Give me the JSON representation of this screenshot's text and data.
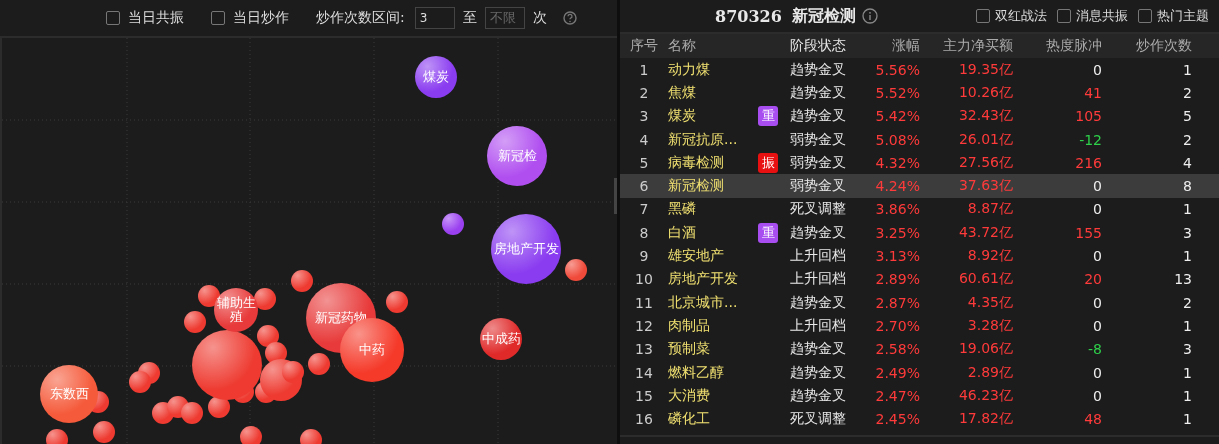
{
  "filter_bar": {
    "checkboxes": [
      {
        "label": "当日共振",
        "checked": false
      },
      {
        "label": "当日炒作",
        "checked": false
      }
    ],
    "range_label": "炒作次数区间:",
    "range_from": {
      "value": "3"
    },
    "range_sep": "至",
    "range_to": {
      "placeholder": "不限"
    },
    "range_unit": "次"
  },
  "bubble_chart": {
    "bubbles": [
      {
        "label": "煤炭",
        "color": "#8a3cf0"
      },
      {
        "label": "新冠检",
        "color": "#b04ef0"
      },
      {
        "label": "房地产开发",
        "color": "#8a3cf0"
      },
      {
        "label": "辅助生殖",
        "color": "#e83a3a"
      },
      {
        "label": "新冠药物",
        "color": "#e83a3a"
      },
      {
        "label": "中药",
        "color": "#f53a2a"
      },
      {
        "label": "中成药",
        "color": "#e02a2a"
      },
      {
        "label": "东数西",
        "color": "#f55a3a"
      }
    ]
  },
  "detail": {
    "code": "870326",
    "title": "新冠检测",
    "options": [
      {
        "label": "双红战法",
        "checked": false
      },
      {
        "label": "消息共振",
        "checked": false
      },
      {
        "label": "热门主题",
        "checked": false
      }
    ],
    "columns": [
      "序号",
      "名称",
      "阶段状态",
      "涨幅",
      "主力净买额",
      "热度脉冲",
      "炒作次数"
    ],
    "rows": [
      {
        "no": "1",
        "name": "动力煤",
        "stage": "趋势金叉",
        "change": "5.56%",
        "net_buy": "19.35亿",
        "heat": {
          "value": "0",
          "color": "#eeeeee"
        },
        "count": "1",
        "selected": false
      },
      {
        "no": "2",
        "name": "焦煤",
        "stage": "趋势金叉",
        "change": "5.52%",
        "net_buy": "10.26亿",
        "heat": {
          "value": "41",
          "color": "#ff3a3a"
        },
        "count": "2",
        "selected": false
      },
      {
        "no": "3",
        "name": "煤炭",
        "tag": {
          "text": "重",
          "color": "#a84ef0"
        },
        "stage": "趋势金叉",
        "change": "5.42%",
        "net_buy": "32.43亿",
        "heat": {
          "value": "105",
          "color": "#ff3a3a"
        },
        "count": "5",
        "selected": false
      },
      {
        "no": "4",
        "name": "新冠抗原...",
        "stage": "弱势金叉",
        "change": "5.08%",
        "net_buy": "26.01亿",
        "heat": {
          "value": "-12",
          "color": "#2ed04a"
        },
        "count": "2",
        "selected": false
      },
      {
        "no": "5",
        "name": "病毒检测",
        "tag": {
          "text": "振",
          "color": "#e81010"
        },
        "stage": "弱势金叉",
        "change": "4.32%",
        "net_buy": "27.56亿",
        "heat": {
          "value": "216",
          "color": "#ff3a3a"
        },
        "count": "4",
        "selected": false
      },
      {
        "no": "6",
        "name": "新冠检测",
        "stage": "弱势金叉",
        "change": "4.24%",
        "net_buy": "37.63亿",
        "heat": {
          "value": "0",
          "color": "#eeeeee"
        },
        "count": "8",
        "selected": true
      },
      {
        "no": "7",
        "name": "黑磷",
        "stage": "死叉调整",
        "change": "3.86%",
        "net_buy": "8.87亿",
        "heat": {
          "value": "0",
          "color": "#eeeeee"
        },
        "count": "1",
        "selected": false
      },
      {
        "no": "8",
        "name": "白酒",
        "tag": {
          "text": "重",
          "color": "#a84ef0"
        },
        "stage": "趋势金叉",
        "change": "3.25%",
        "net_buy": "43.72亿",
        "heat": {
          "value": "155",
          "color": "#ff3a3a"
        },
        "count": "3",
        "selected": false
      },
      {
        "no": "9",
        "name": "雄安地产",
        "stage": "上升回档",
        "change": "3.13%",
        "net_buy": "8.92亿",
        "heat": {
          "value": "0",
          "color": "#eeeeee"
        },
        "count": "1",
        "selected": false
      },
      {
        "no": "10",
        "name": "房地产开发",
        "stage": "上升回档",
        "change": "2.89%",
        "net_buy": "60.61亿",
        "heat": {
          "value": "20",
          "color": "#ff3a3a"
        },
        "count": "13",
        "selected": false
      },
      {
        "no": "11",
        "name": "北京城市...",
        "stage": "趋势金叉",
        "change": "2.87%",
        "net_buy": "4.35亿",
        "heat": {
          "value": "0",
          "color": "#eeeeee"
        },
        "count": "2",
        "selected": false
      },
      {
        "no": "12",
        "name": "肉制品",
        "stage": "上升回档",
        "change": "2.70%",
        "net_buy": "3.28亿",
        "heat": {
          "value": "0",
          "color": "#eeeeee"
        },
        "count": "1",
        "selected": false
      },
      {
        "no": "13",
        "name": "预制菜",
        "stage": "趋势金叉",
        "change": "2.58%",
        "net_buy": "19.06亿",
        "heat": {
          "value": "-8",
          "color": "#2ed04a"
        },
        "count": "3",
        "selected": false
      },
      {
        "no": "14",
        "name": "燃料乙醇",
        "stage": "趋势金叉",
        "change": "2.49%",
        "net_buy": "2.89亿",
        "heat": {
          "value": "0",
          "color": "#eeeeee"
        },
        "count": "1",
        "selected": false
      },
      {
        "no": "15",
        "name": "大消费",
        "stage": "趋势金叉",
        "change": "2.47%",
        "net_buy": "46.23亿",
        "heat": {
          "value": "0",
          "color": "#eeeeee"
        },
        "count": "1",
        "selected": false
      },
      {
        "no": "16",
        "name": "磷化工",
        "stage": "死叉调整",
        "change": "2.45%",
        "net_buy": "17.82亿",
        "heat": {
          "value": "48",
          "color": "#ff3a3a"
        },
        "count": "1",
        "selected": false
      }
    ]
  }
}
